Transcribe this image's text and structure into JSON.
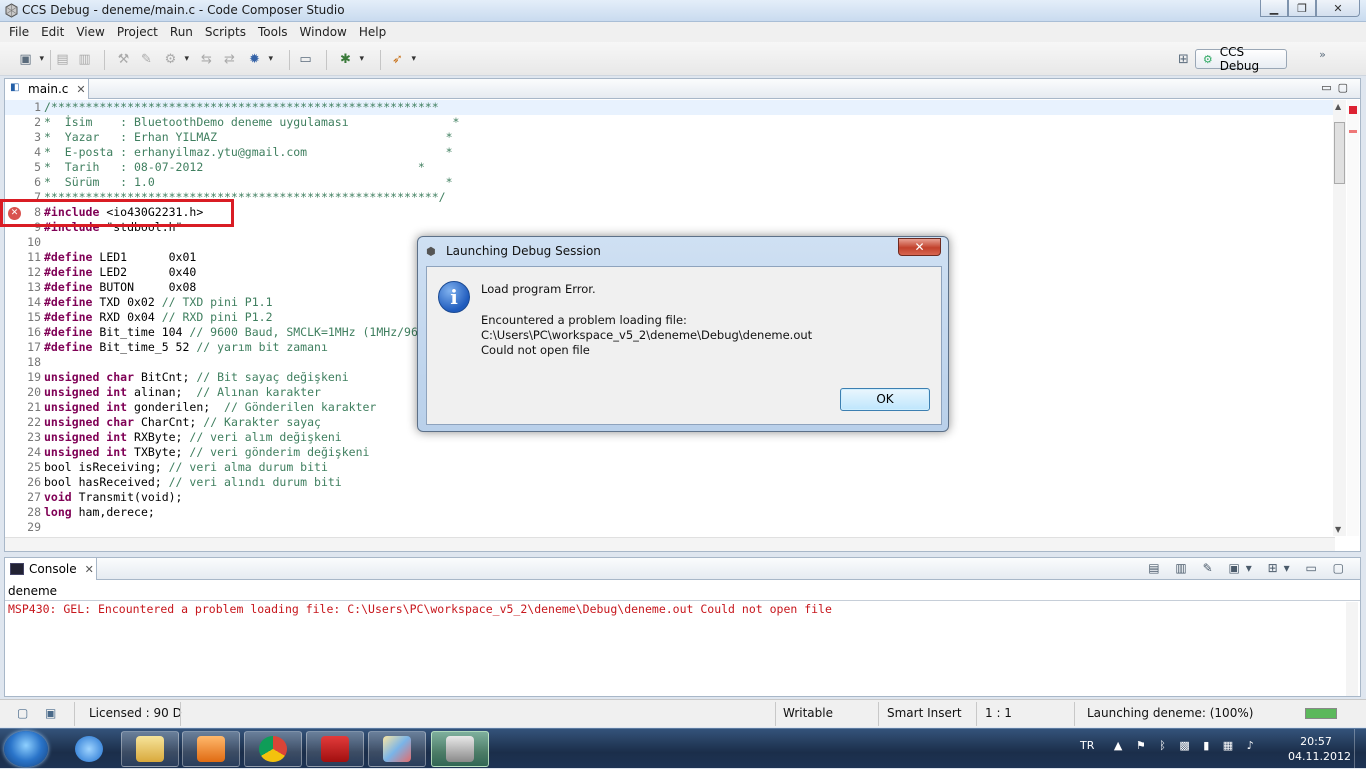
{
  "window": {
    "title": "CCS Debug - deneme/main.c - Code Composer Studio",
    "min_icon": "minimize-icon",
    "max_icon": "maximize-icon",
    "close_icon": "close-icon"
  },
  "menu": [
    "File",
    "Edit",
    "View",
    "Project",
    "Run",
    "Scripts",
    "Tools",
    "Window",
    "Help"
  ],
  "perspective": {
    "label": "CCS Debug"
  },
  "editor": {
    "tab": "main.c",
    "close_glyph": "✕"
  },
  "code": [
    {
      "n": "1",
      "t": "/********************************************************"
    },
    {
      "n": "2",
      "t": "*  İsim    : BluetoothDemo deneme uygulaması               *"
    },
    {
      "n": "3",
      "t": "*  Yazar   : Erhan YILMAZ                                 *"
    },
    {
      "n": "4",
      "t": "*  E-posta : erhanyilmaz.ytu@gmail.com                    *"
    },
    {
      "n": "5",
      "t": "*  Tarih   : 08-07-2012                               *"
    },
    {
      "n": "6",
      "t": "*  Sürüm   : 1.0                                          *"
    },
    {
      "n": "7",
      "t": "*********************************************************/"
    },
    {
      "n": "8",
      "t": "#include <io430G2231.h>"
    },
    {
      "n": "9",
      "t": "#include \"stdbool.h\""
    },
    {
      "n": "10",
      "t": ""
    },
    {
      "n": "11",
      "t": "#define LED1      0x01"
    },
    {
      "n": "12",
      "t": "#define LED2      0x40"
    },
    {
      "n": "13",
      "t": "#define BUTON     0x08"
    },
    {
      "n": "14",
      "t": "#define TXD 0x02 // TXD pini P1.1"
    },
    {
      "n": "15",
      "t": "#define RXD 0x04 // RXD pini P1.2"
    },
    {
      "n": "16",
      "t": "#define Bit_time 104 // 9600 Baud, SMCLK=1MHz (1MHz/96"
    },
    {
      "n": "17",
      "t": "#define Bit_time_5 52 // yarım bit zamanı"
    },
    {
      "n": "18",
      "t": ""
    },
    {
      "n": "19",
      "t": "unsigned char BitCnt; // Bit sayaç değişkeni"
    },
    {
      "n": "20",
      "t": "unsigned int alinan;  // Alınan karakter"
    },
    {
      "n": "21",
      "t": "unsigned int gonderilen;  // Gönderilen karakter"
    },
    {
      "n": "22",
      "t": "unsigned char CharCnt; // Karakter sayaç"
    },
    {
      "n": "23",
      "t": "unsigned int RXByte; // veri alım değişkeni"
    },
    {
      "n": "24",
      "t": "unsigned int TXByte; // veri gönderim değişkeni"
    },
    {
      "n": "25",
      "t": "bool isReceiving; // veri alma durum biti"
    },
    {
      "n": "26",
      "t": "bool hasReceived; // veri alındı durum biti"
    },
    {
      "n": "27",
      "t": "void Transmit(void);"
    },
    {
      "n": "28",
      "t": "long ham,derece;"
    },
    {
      "n": "29",
      "t": ""
    }
  ],
  "dialog": {
    "title": "Launching Debug Session",
    "heading": "Load program Error.",
    "line1": "Encountered a problem loading file:",
    "line2": "C:\\Users\\PC\\workspace_v5_2\\deneme\\Debug\\deneme.out",
    "line3": "Could not open file",
    "ok": "OK",
    "close_glyph": "✕"
  },
  "console": {
    "tab": "Console",
    "close_glyph": "✕",
    "name": "deneme",
    "message": "MSP430: GEL: Encountered a problem loading file: C:\\Users\\PC\\workspace_v5_2\\deneme\\Debug\\deneme.out Could not open file"
  },
  "status": {
    "licensed": "Licensed : 90 D",
    "writable": "Writable",
    "insert": "Smart Insert",
    "position": "1 : 1",
    "launching": "Launching deneme: (100%)",
    "progress": 1.0
  },
  "taskbar": {
    "lang": "TR",
    "time": "20:57",
    "date": "04.11.2012"
  }
}
